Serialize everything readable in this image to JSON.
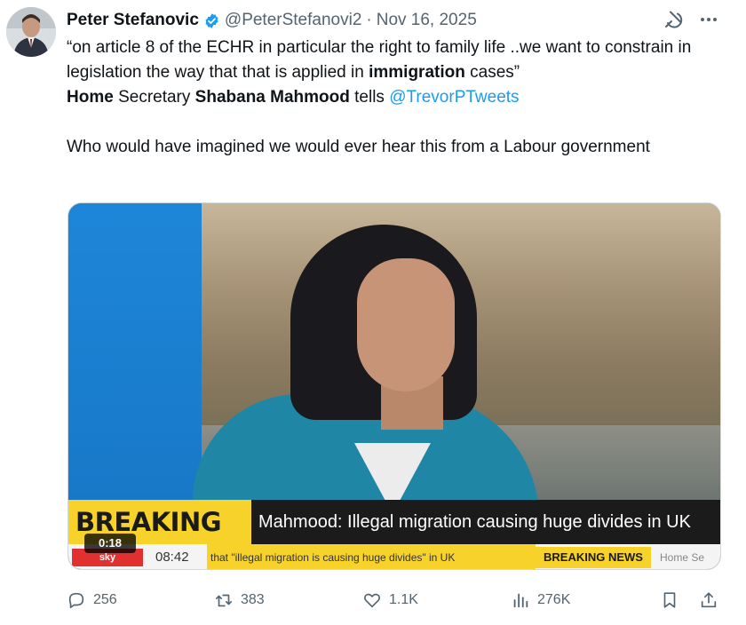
{
  "tweet": {
    "author_name": "Peter Stefanovic",
    "handle": "@PeterStefanovi2",
    "separator": "·",
    "date": "Nov 16, 2025",
    "text": {
      "line1_a": "“on article 8 of the ECHR in particular the right to family life ..we want to constrain in legislation the way that that is applied in ",
      "line1_bold": "immigration",
      "line1_b": " cases”",
      "line2_bold_a": "Home",
      "line2_a": " Secretary ",
      "line2_bold_b": "Shabana Mahmood",
      "line2_b": " tells ",
      "mention": "@TrevorPTweets",
      "para2": "Who would have imagined we would ever hear this from a Labour government"
    }
  },
  "media": {
    "breaking_label": "BREAKING NEWS",
    "headline": "Mahmood: Illegal migration causing huge divides in UK",
    "ticker_time": "08:42",
    "ticker_text": "that \"illegal migration is causing huge divides\" in UK",
    "ticker_breaking": "BREAKING NEWS",
    "ticker_home": "Home Se",
    "duration": "0:18"
  },
  "actions": {
    "replies": "256",
    "reposts": "383",
    "likes": "1.1K",
    "views": "276K"
  },
  "icons": {
    "avatar": "avatar",
    "verified": "verified-badge-icon",
    "grok": "grok-icon",
    "more": "more-icon",
    "reply": "reply-icon",
    "repost": "repost-icon",
    "like": "heart-icon",
    "views": "views-icon",
    "bookmark": "bookmark-icon",
    "share": "share-icon"
  },
  "colors": {
    "accent": "#1d9bf0",
    "secondary_text": "#536471",
    "primary_text": "#0f1419",
    "breaking_yellow": "#f6d22a"
  }
}
